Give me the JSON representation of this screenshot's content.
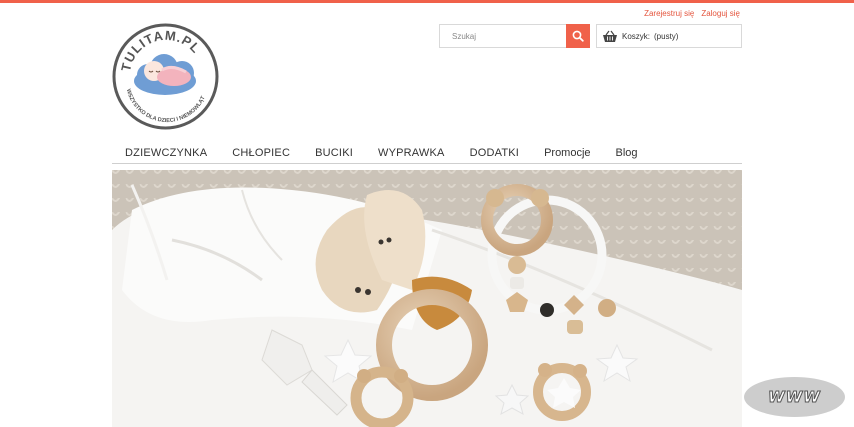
{
  "header": {
    "register_link": "Zarejestruj się",
    "login_link": "Zaloguj się",
    "logo": {
      "brand_text": "TULITAM.PL",
      "tagline": "WSZYSTKO DLA DZIECI I NIEMOWLĄT"
    }
  },
  "search": {
    "placeholder": "Szukaj",
    "button_icon": "search-icon"
  },
  "cart": {
    "icon": "basket-icon",
    "label": "Koszyk:",
    "status": "(pusty)"
  },
  "nav": {
    "items": [
      {
        "label": "DZIEWCZYNKA"
      },
      {
        "label": "CHŁOPIEC"
      },
      {
        "label": "BUCIKI"
      },
      {
        "label": "WYPRAWKA"
      },
      {
        "label": "DODATKI"
      },
      {
        "label": "Promocje"
      },
      {
        "label": "Blog"
      }
    ]
  },
  "badge": {
    "label": "WWW"
  },
  "colors": {
    "accent": "#f0614a",
    "link": "#e4543c",
    "logo_blue": "#5b8fc9",
    "logo_pink": "#f3b3bd"
  }
}
